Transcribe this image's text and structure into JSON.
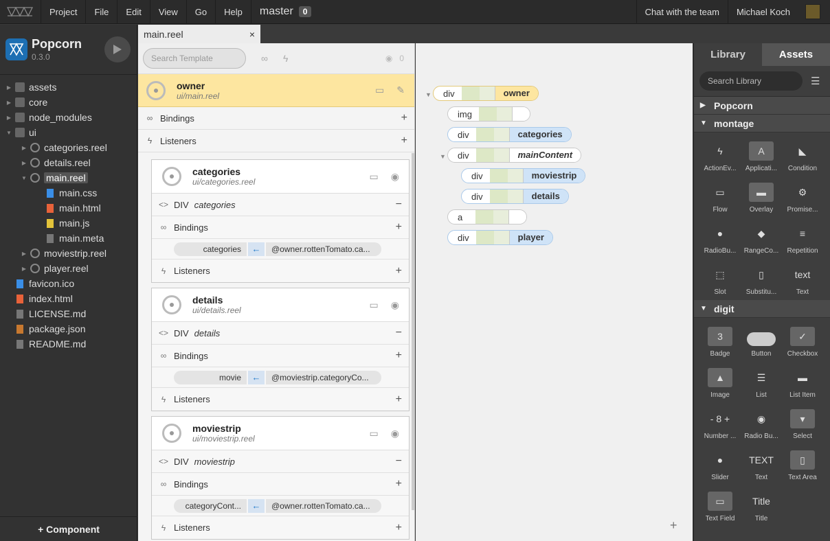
{
  "menubar": {
    "items": [
      "Project",
      "File",
      "Edit",
      "View",
      "Go",
      "Help"
    ],
    "branch": "master",
    "branch_count": "0",
    "chat": "Chat with the team",
    "user": "Michael Koch"
  },
  "app": {
    "title": "Popcorn",
    "version": "0.3.0",
    "component_button": "+ Component"
  },
  "tree": [
    {
      "label": "assets",
      "type": "folder",
      "depth": 0,
      "arrow": "▶"
    },
    {
      "label": "core",
      "type": "folder",
      "depth": 0,
      "arrow": "▶"
    },
    {
      "label": "node_modules",
      "type": "folder",
      "depth": 0,
      "arrow": "▶"
    },
    {
      "label": "ui",
      "type": "folder",
      "depth": 0,
      "arrow": "▼"
    },
    {
      "label": "categories.reel",
      "type": "reel",
      "depth": 1,
      "arrow": "▶"
    },
    {
      "label": "details.reel",
      "type": "reel",
      "depth": 1,
      "arrow": "▶"
    },
    {
      "label": "main.reel",
      "type": "reel",
      "depth": 1,
      "arrow": "▼",
      "selected": true
    },
    {
      "label": "main.css",
      "type": "css",
      "depth": 2,
      "arrow": ""
    },
    {
      "label": "main.html",
      "type": "html",
      "depth": 2,
      "arrow": ""
    },
    {
      "label": "main.js",
      "type": "js",
      "depth": 2,
      "arrow": ""
    },
    {
      "label": "main.meta",
      "type": "meta",
      "depth": 2,
      "arrow": ""
    },
    {
      "label": "moviestrip.reel",
      "type": "reel",
      "depth": 1,
      "arrow": "▶"
    },
    {
      "label": "player.reel",
      "type": "reel",
      "depth": 1,
      "arrow": "▶"
    },
    {
      "label": "favicon.ico",
      "type": "image",
      "depth": 0,
      "arrow": ""
    },
    {
      "label": "index.html",
      "type": "html",
      "depth": 0,
      "arrow": ""
    },
    {
      "label": "LICENSE.md",
      "type": "meta",
      "depth": 0,
      "arrow": ""
    },
    {
      "label": "package.json",
      "type": "package",
      "depth": 0,
      "arrow": ""
    },
    {
      "label": "README.md",
      "type": "meta",
      "depth": 0,
      "arrow": ""
    }
  ],
  "tab": {
    "label": "main.reel",
    "close": "×"
  },
  "outline": {
    "search_placeholder": "Search Template",
    "eye_count": "0",
    "owner": {
      "name": "owner",
      "path": "ui/main.reel",
      "bindings": "Bindings",
      "listeners": "Listeners"
    },
    "cards": [
      {
        "name": "categories",
        "path": "ui/categories.reel",
        "element": "DIV",
        "element_name": "categories",
        "bindings": "Bindings",
        "bind_left": "categories",
        "bind_right": "@owner.rottenTomato.ca...",
        "listeners": "Listeners"
      },
      {
        "name": "details",
        "path": "ui/details.reel",
        "element": "DIV",
        "element_name": "details",
        "bindings": "Bindings",
        "bind_left": "movie",
        "bind_right": "@moviestrip.categoryCo...",
        "listeners": "Listeners"
      },
      {
        "name": "moviestrip",
        "path": "ui/moviestrip.reel",
        "element": "DIV",
        "element_name": "moviestrip",
        "bindings": "Bindings",
        "bind_left": "categoryCont...",
        "bind_right": "@owner.rottenTomato.ca...",
        "listeners": "Listeners"
      }
    ]
  },
  "dom_tree": [
    {
      "tag": "div",
      "name": "owner",
      "style": "yellow"
    },
    {
      "tag": "img",
      "name": "",
      "style": "empty"
    },
    {
      "tag": "div",
      "name": "categories",
      "style": "blue"
    },
    {
      "tag": "div",
      "name": "mainContent",
      "style": "white"
    },
    {
      "tag": "div",
      "name": "moviestrip",
      "style": "blue"
    },
    {
      "tag": "div",
      "name": "details",
      "style": "blue"
    },
    {
      "tag": "a",
      "name": "",
      "style": "empty"
    },
    {
      "tag": "div",
      "name": "player",
      "style": "blue"
    }
  ],
  "library": {
    "tabs": [
      "Library",
      "Assets"
    ],
    "search_placeholder": "Search Library",
    "sections": [
      {
        "name": "Popcorn",
        "expanded": false,
        "items": []
      },
      {
        "name": "montage",
        "expanded": true,
        "items": [
          "ActionEv...",
          "Applicati...",
          "Condition",
          "Flow",
          "Overlay",
          "Promise...",
          "RadioBu...",
          "RangeCo...",
          "Repetition",
          "Slot",
          "Substitu...",
          "Text"
        ]
      },
      {
        "name": "digit",
        "expanded": true,
        "items": [
          "Badge",
          "Button",
          "Checkbox",
          "Image",
          "List",
          "List Item",
          "Number ...",
          "Radio Bu...",
          "Select",
          "Slider",
          "Text",
          "Text Area",
          "Text Field",
          "Title"
        ]
      }
    ],
    "icon_texts": {
      "applicati": "A",
      "badge": "3",
      "text_montage": "text",
      "text_digit": "TEXT",
      "title": "Title",
      "number": "- 8 +"
    }
  },
  "colors": {
    "accent_blue": "#1e78c8",
    "owner_yellow": "#fde6a0",
    "node_blue": "#cfe3f7",
    "binding_green": "#dde8c6"
  }
}
